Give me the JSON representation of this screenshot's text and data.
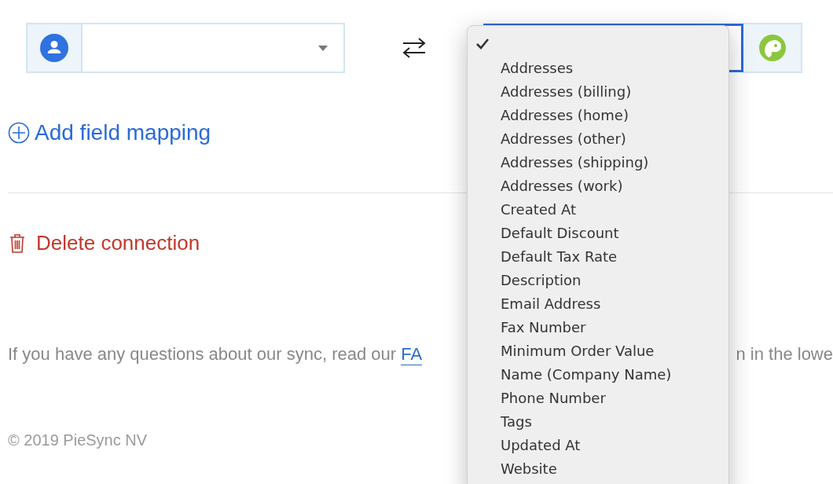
{
  "mapping_row": {
    "right_select": {
      "focused": true
    }
  },
  "add_link": "Add field mapping",
  "delete_link": "Delete connection",
  "help": {
    "text": "If you have any questions about our sync, read our ",
    "link": "FA",
    "tail": "n in the lowe"
  },
  "footer": "© 2019 PieSync NV",
  "menu": [
    {
      "selected": true
    },
    {
      "label": "Addresses",
      "selected": false
    },
    {
      "label": "Addresses (billing)",
      "selected": false
    },
    {
      "label": "Addresses (home)",
      "selected": false
    },
    {
      "label": "Addresses (other)",
      "selected": false
    },
    {
      "label": "Addresses (shipping)",
      "selected": false
    },
    {
      "label": "Addresses (work)",
      "selected": false
    },
    {
      "label": "Created At",
      "selected": false
    },
    {
      "label": "Default Discount",
      "selected": false
    },
    {
      "label": "Default Tax Rate",
      "selected": false
    },
    {
      "label": "Description",
      "selected": false
    },
    {
      "label": "Email Address",
      "selected": false
    },
    {
      "label": "Fax Number",
      "selected": false
    },
    {
      "label": "Minimum Order Value",
      "selected": false
    },
    {
      "label": "Name (Company Name)",
      "selected": false
    },
    {
      "label": "Phone Number",
      "selected": false
    },
    {
      "label": "Tags",
      "selected": false
    },
    {
      "label": "Updated At",
      "selected": false
    },
    {
      "label": "Website",
      "selected": false
    }
  ]
}
